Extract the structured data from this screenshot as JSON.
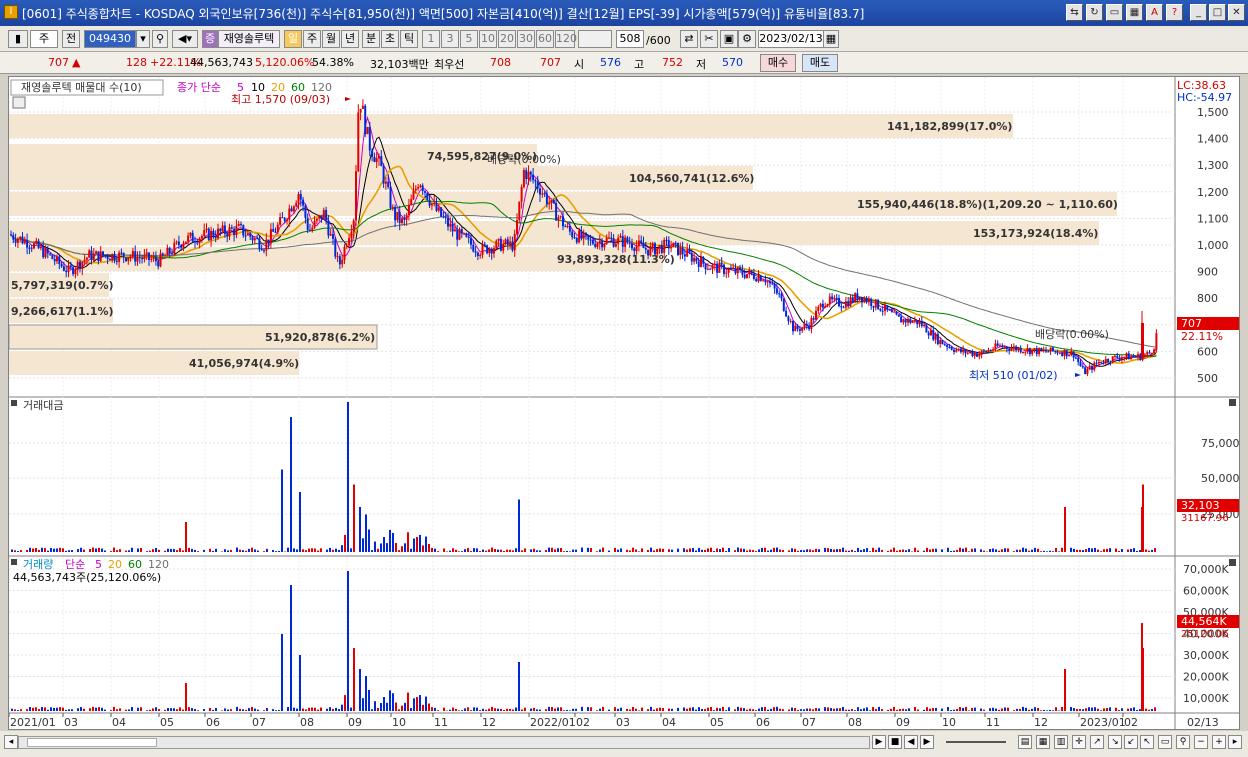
{
  "window": {
    "title": "[0601] 주식종합차트 - KOSDAQ 외국인보유[736(천)] 주식수[81,950(천)] 액면[500] 자본금[410(억)] 결산[12월] EPS[-39] 시가총액[579(억)] 유통비율[83.7]",
    "app_icon": "app-icon-I"
  },
  "toolbar": {
    "period_select": "주",
    "prev_label": "전",
    "code_value": "049430",
    "search_icon": "search-icon",
    "speaker_icon": "speaker-icon",
    "stock_badge": "증",
    "stock_name": "재영솔루텍",
    "period_buttons": [
      "일",
      "주",
      "월",
      "년",
      "분",
      "초",
      "틱"
    ],
    "interval_buttons": [
      "1",
      "3",
      "5",
      "10",
      "20",
      "30",
      "60",
      "120"
    ],
    "count_value": "508",
    "count_total": "/600",
    "date_value": "2023/02/13"
  },
  "quote": {
    "price": "707",
    "arrow": "▲",
    "change": "128",
    "change_pct": "+22.11%",
    "volume": "44,563,743",
    "volume_pct": "5,120.06%",
    "turnover_pct": "54.38%",
    "amount": "32,103백만",
    "best_label": "최우선",
    "best_ask": "708",
    "best_bid": "707",
    "open_label": "시",
    "open": "576",
    "high_label": "고",
    "high": "752",
    "low_label": "저",
    "low": "570",
    "buy_label": "매수",
    "sell_label": "매도"
  },
  "panel_price": {
    "title": "재영솔루텍 매물대 수(10)",
    "ma_label": "종가 단순",
    "ma_periods": [
      "5",
      "10",
      "20",
      "60",
      "120"
    ],
    "ma_colors": [
      "#c800c8",
      "#000000",
      "#e8a000",
      "#008000",
      "#707070"
    ],
    "lc": "LC:38.63",
    "hc": "HC:-54.97",
    "last_price": "707",
    "last_pct": "22.11%",
    "ticks": [
      "1,500",
      "1,400",
      "1,300",
      "1,200",
      "1,100",
      "1,000",
      "900",
      "800",
      "700",
      "600",
      "500"
    ],
    "max_label": "최고 1,570 (09/03)",
    "min_label": "최저 510 (01/02)",
    "div_label1": "배당락(0.00%)",
    "div_label2": "배당락(0.00%)",
    "profile": [
      "141,182,899(17.0%)",
      "155,940,446(18.8%)(1,209.20 ~ 1,110.60)",
      "104,560,741(12.6%)",
      "74,595,827(9.0%)",
      "153,173,924(18.4%)",
      "93,893,328(11.3%)",
      "5,797,319(0.7%)",
      "9,266,617(1.1%)",
      "51,920,878(6.2%)",
      "41,056,974(4.9%)"
    ]
  },
  "panel_amount": {
    "title": "거래대금",
    "ticks": [
      "75,000",
      "50,000",
      "25,000"
    ],
    "last": "32,103",
    "last2": "31167.96"
  },
  "panel_volume": {
    "title": "거래량",
    "ma_label": "단순",
    "ma_periods": [
      "5",
      "20",
      "60",
      "120"
    ],
    "info": "44,563,743주(25,120.06%)",
    "ticks": [
      "70,000K",
      "60,000K",
      "50,000K",
      "40,000K",
      "30,000K",
      "20,000K",
      "10,000K"
    ],
    "last": "44,564K",
    "last2": "25120.06"
  },
  "xaxis": {
    "labels": [
      "2021/01",
      "03",
      "04",
      "05",
      "06",
      "07",
      "08",
      "09",
      "10",
      "11",
      "12",
      "2022/01",
      "02",
      "03",
      "04",
      "05",
      "06",
      "07",
      "08",
      "09",
      "10",
      "11",
      "12",
      "2023/01",
      "02"
    ],
    "right_label": "02/13"
  },
  "colors": {
    "up": "#e00000",
    "down": "#0028d8",
    "profile_fill": "#f5e6d2",
    "title_bg": "#1c43a0"
  }
}
